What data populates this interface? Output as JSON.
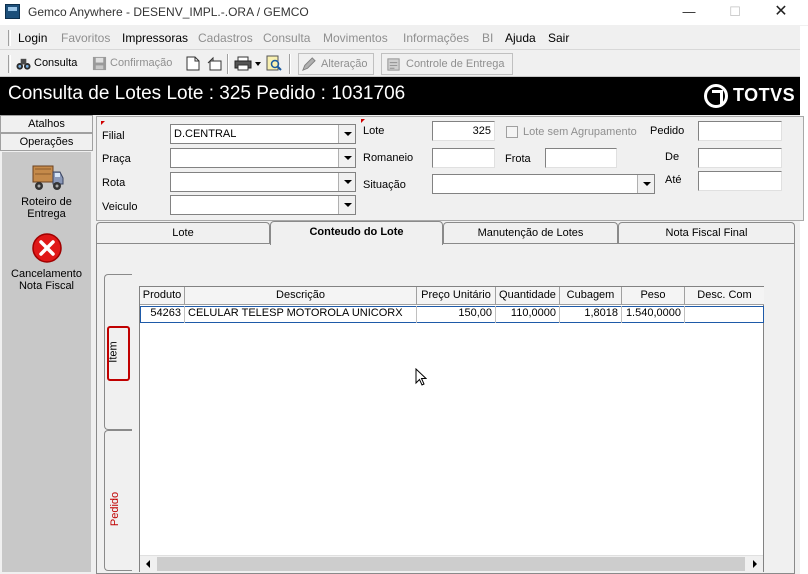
{
  "window": {
    "title": "Gemco Anywhere - DESENV_IMPL.-.ORA / GEMCO"
  },
  "menu": [
    {
      "label": "Login",
      "enabled": true
    },
    {
      "label": "Favoritos",
      "enabled": false
    },
    {
      "label": "Impressoras",
      "enabled": true
    },
    {
      "label": "Cadastros",
      "enabled": false
    },
    {
      "label": "Consulta",
      "enabled": false
    },
    {
      "label": "Movimentos",
      "enabled": false
    },
    {
      "label": "Informações",
      "enabled": false
    },
    {
      "label": "BI",
      "enabled": false
    },
    {
      "label": "Ajuda",
      "enabled": true
    },
    {
      "label": "Sair",
      "enabled": true
    }
  ],
  "toolbar": {
    "consulta": "Consulta",
    "confirmacao": "Confirmação",
    "alteracao": "Alteração",
    "controle_entrega": "Controle de Entrega"
  },
  "header": {
    "title": "Consulta de Lotes  Lote : 325 Pedido : 1031706",
    "logo": "TOTVS"
  },
  "sidebar": {
    "tabs": [
      "Atalhos",
      "Operações"
    ],
    "actions": [
      {
        "label": "Roteiro de Entrega",
        "icon": "truck-icon"
      },
      {
        "label": "Cancelamento Nota Fiscal",
        "icon": "cancel-icon"
      }
    ]
  },
  "filters": {
    "filial_label": "Filial",
    "filial_value": "D.CENTRAL",
    "praca_label": "Praça",
    "rota_label": "Rota",
    "veiculo_label": "Veiculo",
    "lote_label": "Lote",
    "lote_value": "325",
    "lote_sem_agrupamento": "Lote sem Agrupamento",
    "romaneio_label": "Romaneio",
    "frota_label": "Frota",
    "situacao_label": "Situação",
    "pedido_label": "Pedido",
    "de_label": "De",
    "ate_label": "Até"
  },
  "tabs": [
    {
      "label": "Lote",
      "active": false
    },
    {
      "label": "Conteudo do Lote",
      "active": true
    },
    {
      "label": "Manutenção de Lotes",
      "active": false
    },
    {
      "label": "Nota Fiscal Final",
      "active": false
    }
  ],
  "side_tabs": [
    {
      "label": "Item",
      "active": true
    },
    {
      "label": "Pedido",
      "active": false
    }
  ],
  "grid": {
    "columns": [
      "Produto",
      "Descrição",
      "Preço Unitário",
      "Quantidade",
      "Cubagem",
      "Peso",
      "Desc. Com"
    ],
    "rows": [
      [
        "54263",
        "CELULAR TELESP MOTOROLA UNICORX",
        "150,00",
        "110,0000",
        "1,8018",
        "1.540,0000",
        ""
      ]
    ]
  },
  "colors": {
    "header_bg": "#000000",
    "selected_tab_border": "#c00000",
    "tab_text_red": "#c00000",
    "disabled_text": "#8f8f8f"
  }
}
